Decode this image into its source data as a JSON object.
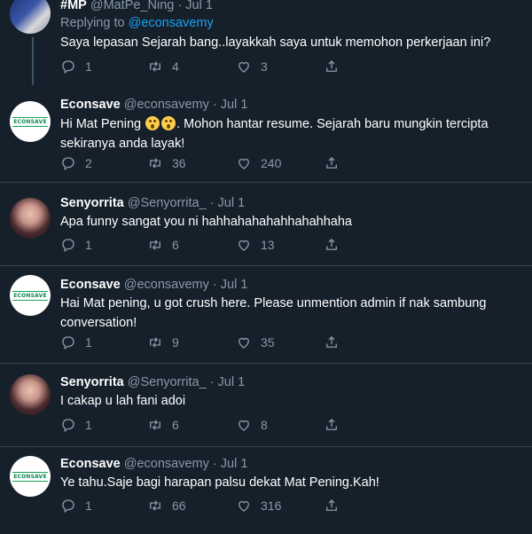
{
  "tweets": [
    {
      "name": "#MP",
      "handle": "@MatPe_Ning",
      "dot": "·",
      "date": "Jul 1",
      "replying_prefix": "Replying to ",
      "replying_to": "@econsavemy",
      "text": "Saya lepasan Sejarah bang..layakkah saya untuk memohon perkerjaan ini?",
      "replies": "1",
      "retweets": "4",
      "likes": "3"
    },
    {
      "name": "Econsave",
      "handle": "@econsavemy",
      "dot": "·",
      "date": "Jul 1",
      "text_before": "Hi Mat Pening ",
      "text_after": ". Mohon hantar resume. Sejarah baru mungkin tercipta sekiranya anda layak!",
      "emoji": "astonished-face",
      "replies": "2",
      "retweets": "36",
      "likes": "240"
    },
    {
      "name": "Senyorrita",
      "handle": "@Senyorrita_",
      "dot": "·",
      "date": "Jul 1",
      "text": "Apa funny sangat you ni hahhahahahahhahahhaha",
      "replies": "1",
      "retweets": "6",
      "likes": "13"
    },
    {
      "name": "Econsave",
      "handle": "@econsavemy",
      "dot": "·",
      "date": "Jul 1",
      "text": "Hai Mat pening, u got crush here. Please unmention admin if nak sambung conversation!",
      "replies": "1",
      "retweets": "9",
      "likes": "35"
    },
    {
      "name": "Senyorrita",
      "handle": "@Senyorrita_",
      "dot": "·",
      "date": "Jul 1",
      "text": "I cakap u lah fani adoi",
      "replies": "1",
      "retweets": "6",
      "likes": "8"
    },
    {
      "name": "Econsave",
      "handle": "@econsavemy",
      "dot": "·",
      "date": "Jul 1",
      "text": "Ye tahu.Saje bagi harapan palsu dekat Mat Pening.Kah!",
      "replies": "1",
      "retweets": "66",
      "likes": "316"
    }
  ],
  "logo_text": "ECONSAVE",
  "colors": {
    "background": "#15202b",
    "secondary_text": "#8899a6",
    "link": "#1da1f2",
    "divider": "#38444d",
    "brand_green": "#16a05b"
  }
}
